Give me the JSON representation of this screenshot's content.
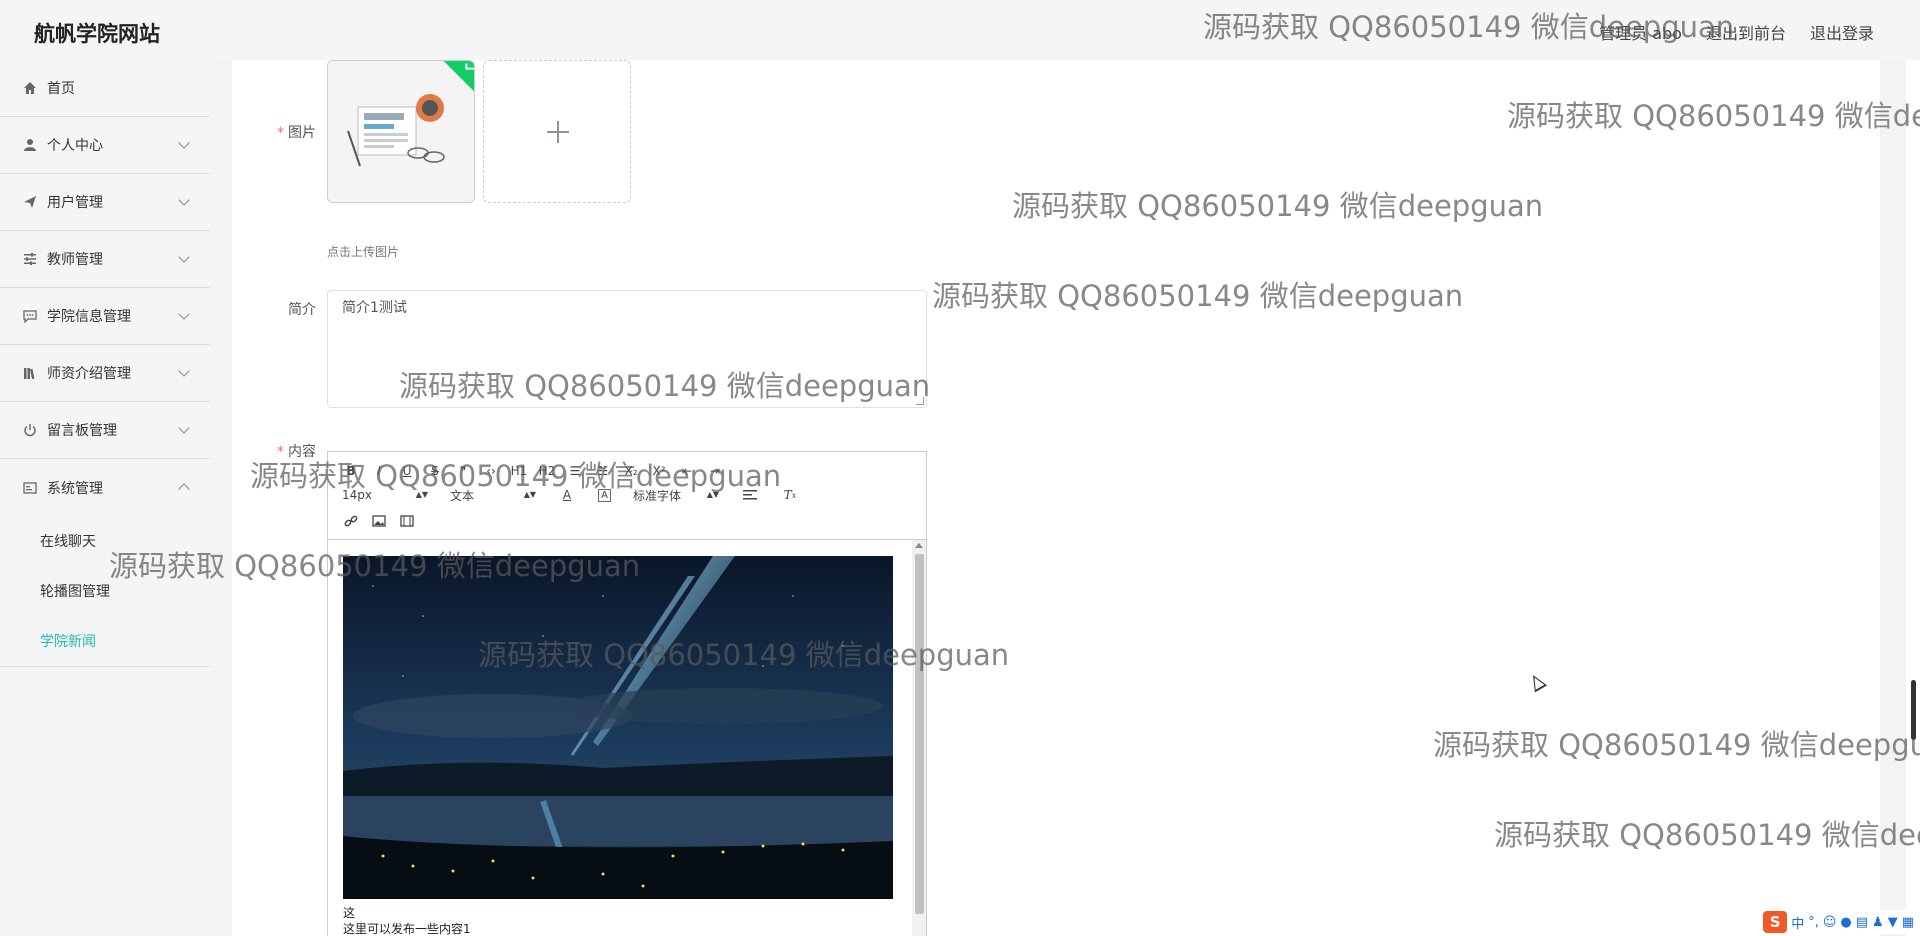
{
  "header": {
    "title": "航帆学院网站",
    "links": [
      "管理员 abo",
      "退出到前台",
      "退出登录"
    ]
  },
  "sidebar": {
    "items": [
      {
        "label": "首页",
        "icon": "home-icon",
        "expandable": false
      },
      {
        "label": "个人中心",
        "icon": "user-icon",
        "expandable": true
      },
      {
        "label": "用户管理",
        "icon": "send-icon",
        "expandable": true
      },
      {
        "label": "教师管理",
        "icon": "sliders-icon",
        "expandable": true
      },
      {
        "label": "学院信息管理",
        "icon": "chat-icon",
        "expandable": true
      },
      {
        "label": "师资介绍管理",
        "icon": "library-icon",
        "expandable": true
      },
      {
        "label": "留言板管理",
        "icon": "power-icon",
        "expandable": true
      },
      {
        "label": "系统管理",
        "icon": "tablet-icon",
        "expandable": true,
        "expanded": true
      }
    ],
    "sub_items": [
      {
        "label": "在线聊天",
        "active": false
      },
      {
        "label": "轮播图管理",
        "active": false
      },
      {
        "label": "学院新闻",
        "active": true
      }
    ],
    "active_color": "#26b8a8"
  },
  "form": {
    "image_label": "图片",
    "upload_tip": "点击上传图片",
    "intro_label": "简介",
    "intro_value": "简介1测试",
    "content_label": "内容",
    "toolbar": {
      "row1": [
        "B",
        "I",
        "U",
        "S",
        "❞",
        "‹›",
        "H1",
        "H2",
        "☰",
        "☷",
        "X₂",
        "X²",
        "⇤",
        "⇥"
      ],
      "font_size": "14px",
      "header_select": "文本",
      "font_family": "标准字体",
      "row3": [
        "link-icon",
        "image-icon",
        "video-icon"
      ]
    },
    "content_lines": [
      "这",
      "这里可以发布一些内容1"
    ]
  },
  "watermark": "源码获取 QQ86050149 微信deepguan",
  "ime": {
    "logo": "S",
    "lang": "中"
  }
}
